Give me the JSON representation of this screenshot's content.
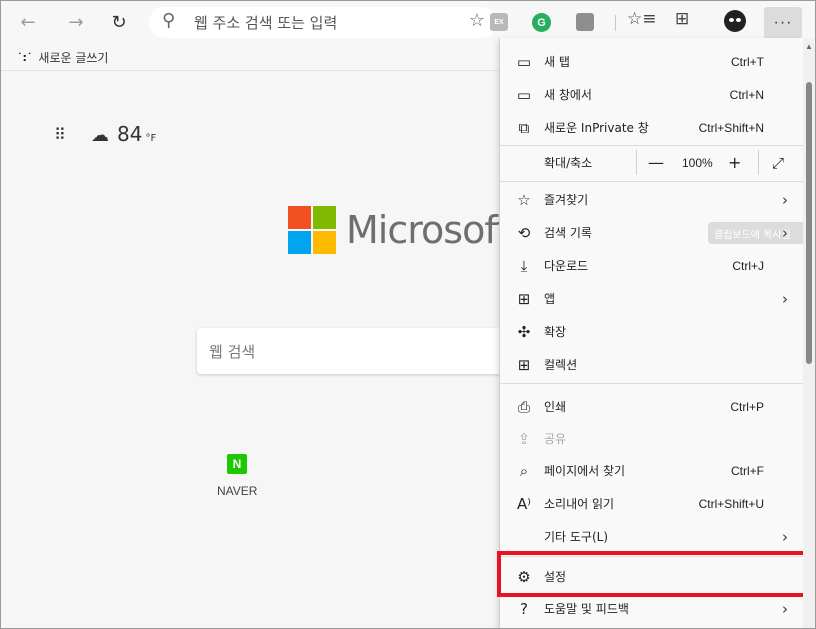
{
  "toolbar": {
    "back_icon": "←",
    "forward_icon": "→",
    "refresh_icon": "↻",
    "address_placeholder": "웹 주소 검색 또는 입력",
    "ext_ex": "EX",
    "ext_g": "G",
    "more_label": "···"
  },
  "favorites": {
    "new_post": "새로운 글쓰기"
  },
  "page": {
    "temperature": "84",
    "temp_unit": "°F",
    "brand": "Microsoft",
    "search_placeholder": "웹 검색",
    "tile_label": "NAVER",
    "tile_letter": "N"
  },
  "menu": {
    "new_tab": {
      "label": "새 탭",
      "shortcut": "Ctrl+T"
    },
    "new_window": {
      "label": "새 창에서",
      "shortcut": "Ctrl+N"
    },
    "inprivate": {
      "label": "새로운 InPrivate 창",
      "shortcut": "Ctrl+Shift+N"
    },
    "zoom": {
      "label": "확대/축소",
      "value": "100%",
      "minus": "—",
      "plus": "+"
    },
    "favorites": {
      "label": "즐겨찾기"
    },
    "history": {
      "label": "검색 기록",
      "tooltip": "클립보드에 복사됨"
    },
    "downloads": {
      "label": "다운로드",
      "shortcut": "Ctrl+J"
    },
    "apps": {
      "label": "앱"
    },
    "extensions": {
      "label": "확장"
    },
    "collections": {
      "label": "컬렉션"
    },
    "print": {
      "label": "인쇄",
      "shortcut": "Ctrl+P"
    },
    "share": {
      "label": "공유"
    },
    "find": {
      "label": "페이지에서 찾기",
      "shortcut": "Ctrl+F"
    },
    "read_aloud": {
      "label": "소리내어 읽기",
      "shortcut": "Ctrl+Shift+U"
    },
    "more_tools": {
      "label": "기타 도구(L)"
    },
    "settings": {
      "label": "설정"
    },
    "help": {
      "label": "도움말 및 피드백"
    }
  },
  "colors": {
    "highlight": "#e8131f",
    "ms_red": "#f25022",
    "ms_green": "#7fba00",
    "ms_blue": "#00a4ef",
    "ms_yellow": "#ffb900",
    "naver_green": "#1ec800"
  }
}
